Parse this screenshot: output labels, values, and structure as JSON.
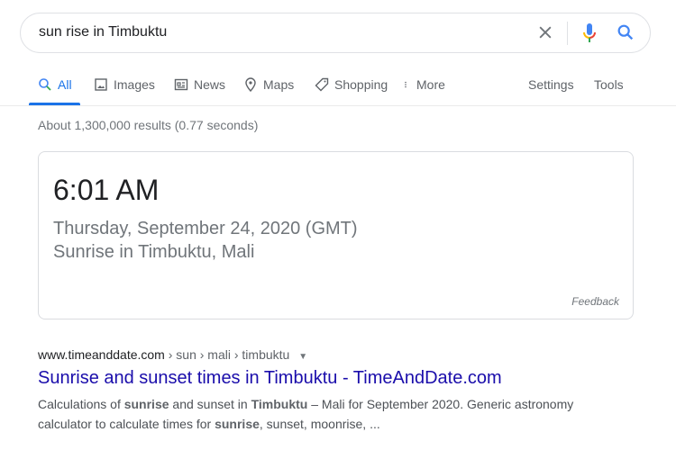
{
  "search": {
    "query": "sun rise in Timbuktu",
    "clear_icon": "close-icon",
    "voice_icon": "mic-icon",
    "search_icon": "search-icon"
  },
  "tabs": [
    {
      "label": "All",
      "icon": "search-icon",
      "active": true
    },
    {
      "label": "Images",
      "icon": "image-icon"
    },
    {
      "label": "News",
      "icon": "newspaper-icon"
    },
    {
      "label": "Maps",
      "icon": "map-pin-icon"
    },
    {
      "label": "Shopping",
      "icon": "tag-icon"
    },
    {
      "label": "More",
      "icon": "more-vertical-icon"
    }
  ],
  "tools": {
    "settings": "Settings",
    "tools": "Tools"
  },
  "stats": "About 1,300,000 results (0.77 seconds)",
  "answer_card": {
    "time": "6:01 AM",
    "date": "Thursday, September 24, 2020 (GMT)",
    "location": "Sunrise in Timbuktu, Mali",
    "feedback": "Feedback"
  },
  "result": {
    "domain": "www.timeanddate.com",
    "path": " › sun › mali › timbuktu",
    "title": "Sunrise and sunset times in Timbuktu - TimeAndDate.com",
    "snippet": [
      {
        "text": "Calculations of ",
        "bold": false
      },
      {
        "text": "sunrise",
        "bold": true
      },
      {
        "text": " and sunset in ",
        "bold": false
      },
      {
        "text": "Timbuktu",
        "bold": true
      },
      {
        "text": " – Mali for September 2020. Generic astronomy calculator to calculate times for ",
        "bold": false
      },
      {
        "text": "sunrise",
        "bold": true
      },
      {
        "text": ", sunset, moonrise, ...",
        "bold": false
      }
    ]
  },
  "colors": {
    "accent": "#1a73e8",
    "link": "#1a0dab",
    "muted": "#70757a"
  }
}
